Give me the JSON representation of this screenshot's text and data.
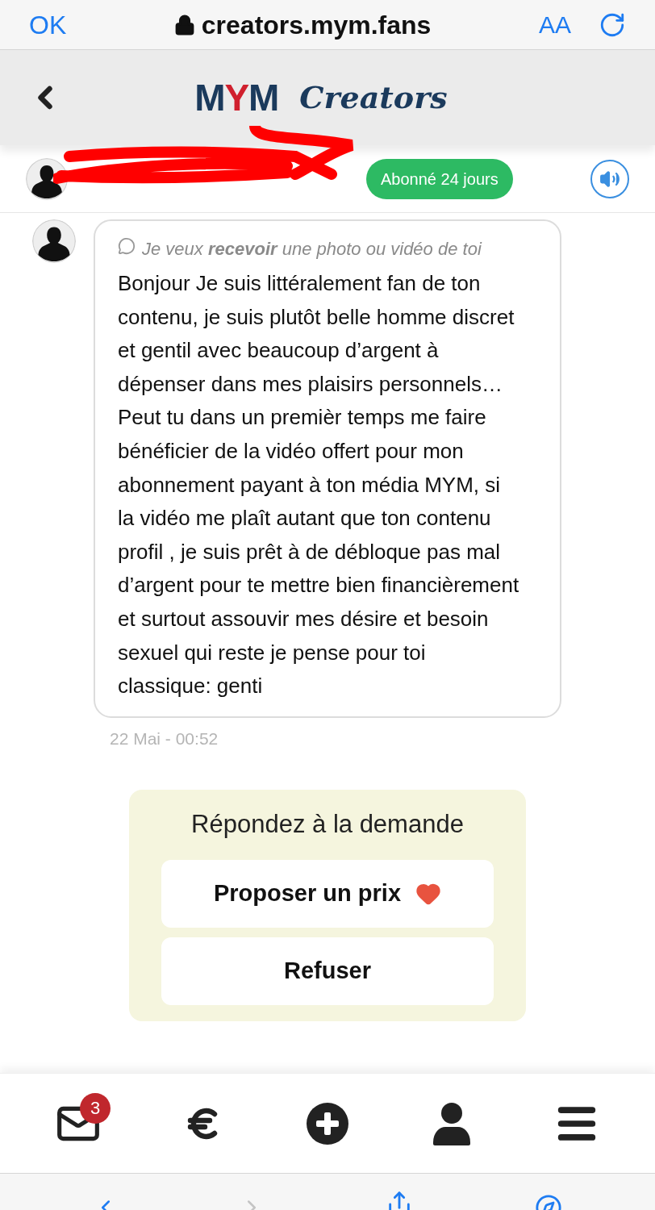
{
  "browser": {
    "done": "OK",
    "url": "creators.mym.fans",
    "text_size": "AA"
  },
  "header": {
    "logo": [
      {
        "text": "M",
        "color": "#1b3a5c"
      },
      {
        "text": "Y",
        "color": "#d0202e"
      },
      {
        "text": "M",
        "color": "#1b3a5c"
      }
    ],
    "brand": "Creators"
  },
  "subscriber": {
    "badge": "Abonné 24 jours"
  },
  "message": {
    "request": "Je veux **recevoir** une photo ou vidéo de toi",
    "text": "Bonjour Je suis littéralement fan de ton contenu, je suis plutôt belle homme discret et gentil avec beaucoup d’argent à dépenser dans mes plaisirs personnels… Peut tu dans un premièr temps me faire bénéficier de la vidéo offert pour mon abonnement payant à ton média MYM, si la vidéo me plaît autant que ton contenu profil , je suis prêt à de débloque pas mal d’argent pour te mettre bien financièrement et surtout assouvir mes désire et besoin sexuel qui reste je pense pour toi classique: genti",
    "time": "22 Mai - 00:52"
  },
  "reply_card": {
    "title": "Répondez à la demande",
    "buttons": [
      {
        "label": "Proposer un prix",
        "kind": "heart"
      },
      {
        "label": "Refuser",
        "kind": "plain"
      }
    ]
  },
  "tab_bar": [
    {
      "kind": "mail",
      "badge": "3"
    },
    {
      "kind": "euro"
    },
    {
      "kind": "plus"
    },
    {
      "kind": "user"
    },
    {
      "kind": "menu"
    }
  ]
}
